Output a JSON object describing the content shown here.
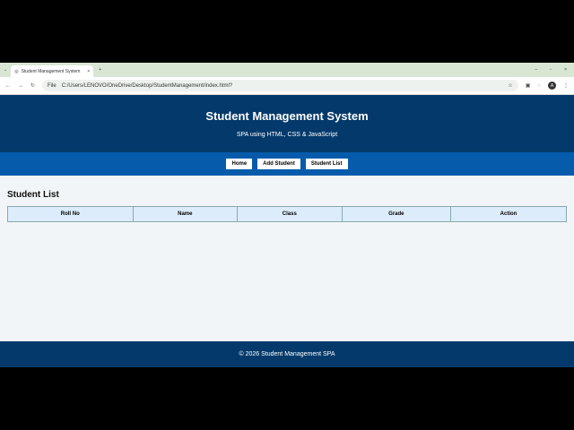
{
  "browser": {
    "tab_title": "Student Management System",
    "url_scheme": "File",
    "url": "C:/Users/LENOVO/OneDrive/Desktop/StudentManagement/index.html?",
    "profile_initial": "A"
  },
  "header": {
    "title": "Student Management System",
    "subtitle": "SPA using HTML, CSS & JavaScript"
  },
  "nav": [
    "Home",
    "Add Student",
    "Student List"
  ],
  "section": {
    "title": "Student List",
    "columns": [
      "Roll No",
      "Name",
      "Class",
      "Grade",
      "Action"
    ]
  },
  "footer": "© 2026 Student Management SPA"
}
